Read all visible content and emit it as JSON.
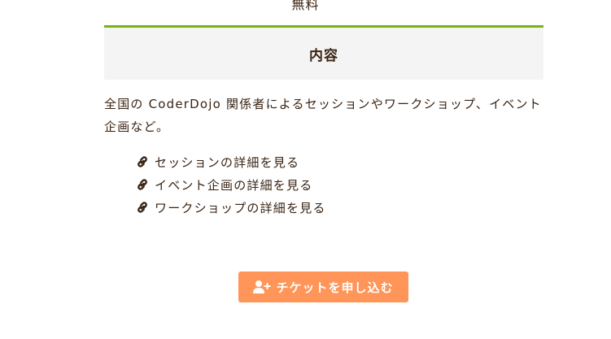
{
  "fee": {
    "value": "無料"
  },
  "content_section": {
    "heading": "内容",
    "description": "全国の CoderDojo 関係者によるセッションやワークショップ、イベント企画など。",
    "links": [
      {
        "label": "セッションの詳細を見る",
        "icon": "link-icon"
      },
      {
        "label": "イベント企画の詳細を見る",
        "icon": "link-icon"
      },
      {
        "label": "ワークショップの詳細を見る",
        "icon": "link-icon"
      }
    ]
  },
  "apply_button": {
    "label": "チケットを申し込む",
    "icon": "user-plus-icon"
  },
  "colors": {
    "accent_border": "#7ab317",
    "button": "#ff9558",
    "text": "#3a2414",
    "header_bg": "#f4f4f4"
  }
}
